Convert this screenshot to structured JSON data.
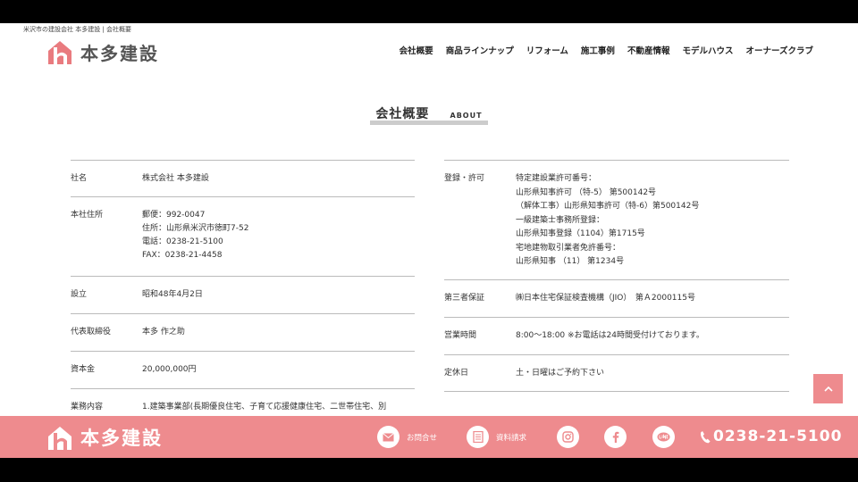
{
  "header": {
    "tagline": "米沢市の建設会社 本多建設 | 会社概要",
    "logo_text": "本多建設",
    "nav": [
      "会社概要",
      "商品ラインナップ",
      "リフォーム",
      "施工事例",
      "不動産情報",
      "モデルハウス",
      "オーナーズクラブ"
    ]
  },
  "section": {
    "title_jp": "会社概要",
    "title_en": "ABOUT"
  },
  "left_rows": [
    {
      "label": "社名",
      "lines": [
        "株式会社 本多建設"
      ]
    },
    {
      "label": "本社住所",
      "lines": [
        "郵便：992-0047",
        "住所：山形県米沢市徳町7-52",
        "電話：0238-21-5100",
        "FAX：0238-21-4458"
      ]
    },
    {
      "label": "設立",
      "lines": [
        "昭和48年4月2日"
      ]
    },
    {
      "label": "代表取締役",
      "lines": [
        "本多 作之助"
      ]
    },
    {
      "label": "資本金",
      "lines": [
        "20,000,000円"
      ]
    },
    {
      "label": "業務内容",
      "lines": [
        "1.建築事業部(長期優良住宅、子育て応援健康住宅、二世帯住宅、別"
      ]
    }
  ],
  "right_rows": [
    {
      "label": "登録・許可",
      "lines": [
        "特定建設業許可番号：",
        "山形県知事許可 （特-5） 第500142号",
        "（解体工事）山形県知事許可（特-6）第500142号",
        "一級建築士事務所登録：",
        "山形県知事登録（1104）第1715号",
        "宅地建物取引業者免許番号：",
        "山形県知事 （11） 第1234号"
      ]
    },
    {
      "label": "第三者保証",
      "lines": [
        "㈱日本住宅保証検査機構（JIO）　第Ａ2000115号"
      ]
    },
    {
      "label": "営業時間",
      "lines": [
        "8:00〜18:00 ※お電話は24時間受付けております。"
      ]
    },
    {
      "label": "定休日",
      "lines": [
        "土・日曜はご予約下さい"
      ]
    }
  ],
  "footer": {
    "logo_text": "本多建設",
    "contact_label": "お問合せ",
    "request_label": "資料請求",
    "tel": "0238-21-5100",
    "icons": [
      "mail-icon",
      "document-icon",
      "instagram-icon",
      "facebook-icon",
      "line-icon",
      "phone-icon"
    ]
  },
  "colors": {
    "brand_pink": "#ee8b8e",
    "accent": "#e97b7f"
  }
}
